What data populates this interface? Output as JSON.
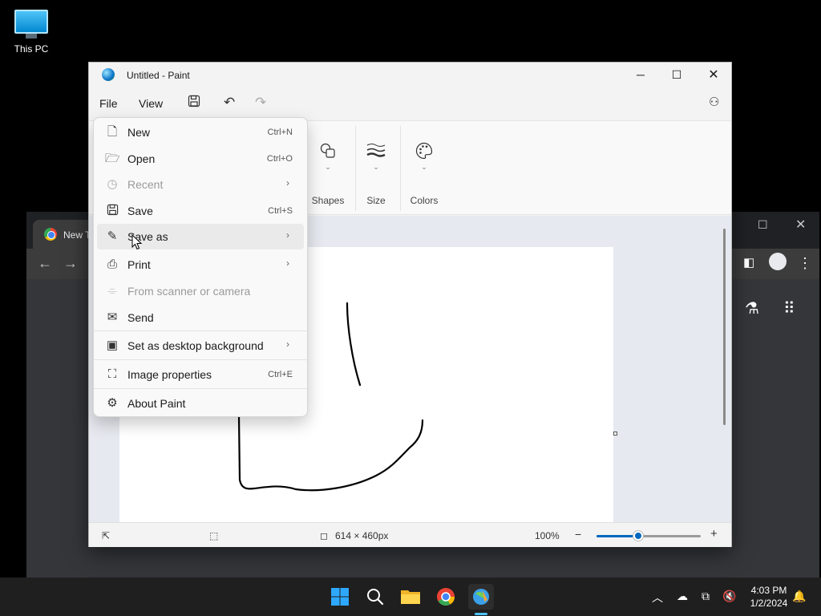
{
  "desktop": {
    "icon_label": "This PC"
  },
  "chrome": {
    "tab_title": "New T"
  },
  "paint": {
    "title": "Untitled - Paint",
    "menu": {
      "file": "File",
      "view": "View"
    },
    "ribbon": {
      "shapes": "Shapes",
      "size": "Size",
      "colors": "Colors"
    },
    "status": {
      "dimensions": "614 × 460px",
      "zoom": "100%",
      "zoom_level": 0.4
    }
  },
  "file_menu": {
    "items": [
      {
        "label": "New",
        "shortcut": "Ctrl+N"
      },
      {
        "label": "Open",
        "shortcut": "Ctrl+O"
      },
      {
        "label": "Recent",
        "shortcut": ""
      },
      {
        "label": "Save",
        "shortcut": "Ctrl+S"
      },
      {
        "label": "Save as",
        "shortcut": ""
      },
      {
        "label": "Print",
        "shortcut": ""
      },
      {
        "label": "From scanner or camera",
        "shortcut": ""
      },
      {
        "label": "Send",
        "shortcut": ""
      },
      {
        "label": "Set as desktop background",
        "shortcut": ""
      },
      {
        "label": "Image properties",
        "shortcut": "Ctrl+E"
      },
      {
        "label": "About Paint",
        "shortcut": ""
      }
    ]
  },
  "taskbar": {
    "time": "4:03 PM",
    "date": "1/2/2024"
  },
  "colors": {
    "accent": "#0067c0",
    "taskbar": "#1f1f1f"
  }
}
